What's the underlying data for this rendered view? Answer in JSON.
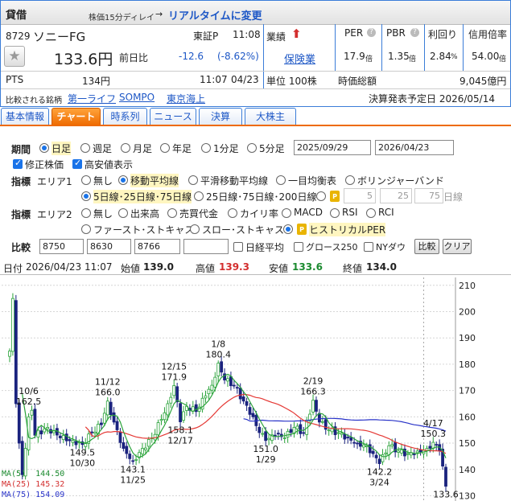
{
  "header": {
    "category": "貸借",
    "delay_note": "株価15分ディレイ",
    "realtime_link": "リアルタイムに変更",
    "code": "8729",
    "name": "ソニーFG",
    "market": "東証P",
    "time": "11:08",
    "price": "133.6円",
    "change_label": "前日比",
    "change": "-12.6",
    "change_pct": "(-8.62%)",
    "industry_label": "業績",
    "industry": "保険業",
    "unit": "単位 100株",
    "pts_label": "PTS",
    "pts_price": "134円",
    "pts_time": "11:07",
    "pts_date": "04/23",
    "market_cap_label": "時価総額",
    "market_cap": "9,045億円",
    "compare_label": "比較される銘柄",
    "compare_links": [
      "第一ライフ",
      "SOMPO",
      "東京海上"
    ],
    "earnings": "決算発表予定日 2026/05/14",
    "metrics": [
      {
        "label": "PER",
        "value": "17.9",
        "unit": "倍"
      },
      {
        "label": "PBR",
        "value": "1.35",
        "unit": "倍"
      },
      {
        "label": "利回り",
        "value": "2.84",
        "unit": "%"
      },
      {
        "label": "信用倍率",
        "value": "54.00",
        "unit": "倍"
      }
    ]
  },
  "tabs": [
    "基本情報",
    "チャート",
    "時系列",
    "ニュース",
    "決算",
    "大株主"
  ],
  "controls": {
    "period_label": "期間",
    "periods": [
      "日足",
      "週足",
      "月足",
      "年足",
      "1分足",
      "5分足"
    ],
    "date_from": "2025/09/29",
    "date_to": "2026/04/23",
    "check_adjusted": "修正株価",
    "check_highlow": "高安値表示",
    "indicator_label": "指標",
    "area1_label": "エリア1",
    "area1_opts": [
      "無し",
      "移動平均線",
      "平滑移動平均線",
      "一目均衡表",
      "ボリンジャーバンド"
    ],
    "ma_opt1": "5日線･25日線･75日線",
    "ma_opt2": "25日線･75日線･200日線",
    "ma_custom": [
      "5",
      "25",
      "75"
    ],
    "ma_custom_unit": "日線",
    "area2_label": "エリア2",
    "area2_opts": [
      "無し",
      "出来高",
      "売買代金",
      "カイリ率",
      "MACD",
      "RSI",
      "RCI"
    ],
    "area2_opts_row2": [
      "ファースト･ストキャス",
      "スロー･ストキャス",
      "ヒストリカルPER"
    ],
    "compare_label": "比較",
    "compare_codes": [
      "8750",
      "8630",
      "8766",
      ""
    ],
    "compare_checks": [
      "日経平均",
      "グロース250",
      "NYダウ"
    ],
    "compare_btn": "比較",
    "clear_btn": "クリア"
  },
  "chart_info": {
    "date_label": "日付",
    "date": "2026/04/23 11:07",
    "open_label": "始値",
    "open": "139.0",
    "high_label": "高値",
    "high": "139.3",
    "low_label": "安値",
    "low": "133.6",
    "close_label": "終値",
    "close": "134.0"
  },
  "colors": {
    "up": "#2aa33a",
    "down": "#1a237e",
    "ma5": "#2aa33a",
    "ma25": "#e53935",
    "ma75": "#2933c8",
    "accent": "#ee6a00",
    "brand": "#1d57c6"
  },
  "chart_data": {
    "type": "candlestick",
    "ylim": [
      128,
      213
    ],
    "yticks": [
      130,
      140,
      150,
      160,
      170,
      180,
      190,
      200,
      210
    ],
    "grid": true,
    "ma_legend": [
      {
        "name": "MA(5)",
        "value": "144.50"
      },
      {
        "name": "MA(25)",
        "value": "145.32"
      },
      {
        "name": "MA(75)",
        "value": "154.09"
      }
    ],
    "annotations": [
      {
        "date": "10/6",
        "value": "162.5",
        "day": 6,
        "pos": "above"
      },
      {
        "date": "10/30",
        "value": "149.5",
        "day": 23,
        "pos": "below"
      },
      {
        "date": "11/12",
        "value": "166.0",
        "day": 31,
        "pos": "above"
      },
      {
        "date": "11/25",
        "value": "143.1",
        "day": 39,
        "pos": "below"
      },
      {
        "date": "12/15",
        "value": "171.9",
        "day": 52,
        "pos": "above"
      },
      {
        "date": "12/17",
        "value": "158.1",
        "day": 54,
        "pos": "below"
      },
      {
        "date": "1/8",
        "value": "180.4",
        "day": 66,
        "pos": "above"
      },
      {
        "date": "1/29",
        "value": "151.0",
        "day": 81,
        "pos": "below"
      },
      {
        "date": "2/19",
        "value": "166.3",
        "day": 96,
        "pos": "above"
      },
      {
        "date": "3/24",
        "value": "142.2",
        "day": 117,
        "pos": "below"
      },
      {
        "date": "4/17",
        "value": "150.3",
        "day": 134,
        "pos": "above"
      },
      {
        "date": "4/23",
        "value": "133.6",
        "day": 138,
        "pos": "below"
      }
    ],
    "keypoints": [
      [
        0,
        185
      ],
      [
        1,
        205
      ],
      [
        2,
        165
      ],
      [
        3,
        150
      ],
      [
        4,
        138
      ],
      [
        5,
        148
      ],
      [
        6,
        160
      ],
      [
        7,
        162.5
      ],
      [
        8,
        153
      ],
      [
        12,
        156
      ],
      [
        16,
        152
      ],
      [
        20,
        151
      ],
      [
        23,
        149.5
      ],
      [
        26,
        154
      ],
      [
        29,
        157
      ],
      [
        31,
        166
      ],
      [
        33,
        158
      ],
      [
        36,
        148
      ],
      [
        39,
        143.1
      ],
      [
        42,
        148
      ],
      [
        45,
        152
      ],
      [
        48,
        159
      ],
      [
        50,
        165
      ],
      [
        52,
        171.9
      ],
      [
        54,
        158.1
      ],
      [
        56,
        164
      ],
      [
        59,
        162
      ],
      [
        62,
        168
      ],
      [
        64,
        172
      ],
      [
        66,
        180.4
      ],
      [
        68,
        174
      ],
      [
        71,
        172
      ],
      [
        74,
        166
      ],
      [
        77,
        160
      ],
      [
        79,
        154
      ],
      [
        81,
        151
      ],
      [
        84,
        153
      ],
      [
        87,
        152
      ],
      [
        90,
        156
      ],
      [
        93,
        154
      ],
      [
        96,
        166.3
      ],
      [
        98,
        158
      ],
      [
        101,
        155
      ],
      [
        104,
        154
      ],
      [
        107,
        152
      ],
      [
        110,
        150
      ],
      [
        113,
        149
      ],
      [
        115,
        146
      ],
      [
        117,
        142.2
      ],
      [
        120,
        149
      ],
      [
        123,
        147
      ],
      [
        126,
        146
      ],
      [
        129,
        147
      ],
      [
        132,
        148
      ],
      [
        134,
        150.3
      ],
      [
        136,
        147
      ],
      [
        138,
        133.6
      ]
    ]
  }
}
